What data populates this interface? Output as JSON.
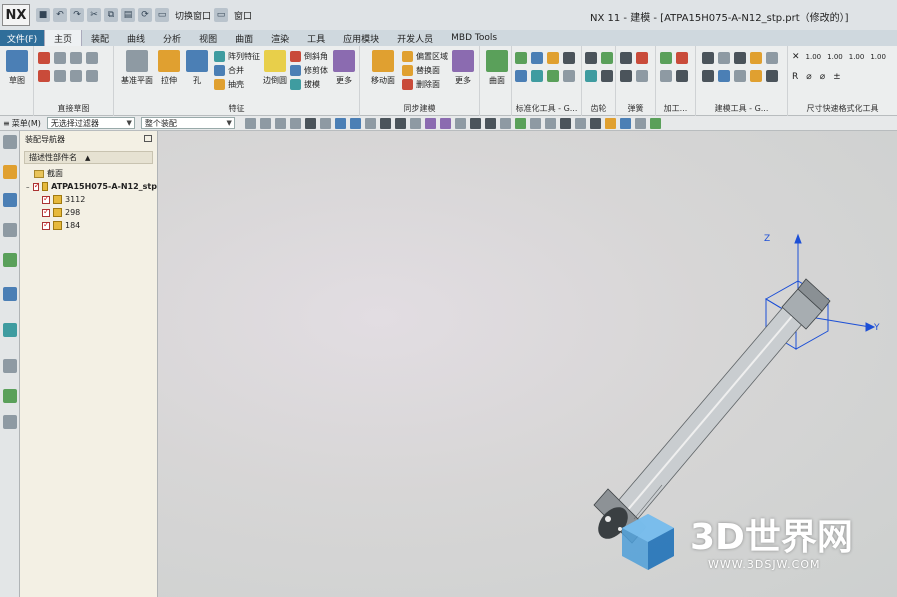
{
  "app": {
    "logo": "NX",
    "window_title": "NX 11 - 建模 - [ATPA15H075-A-N12_stp.prt（修改的）]",
    "quick_access": {
      "switch_window": "切换窗口",
      "window_menu": "窗口"
    }
  },
  "tabs": [
    {
      "label": "文件(F)"
    },
    {
      "label": "主页"
    },
    {
      "label": "装配"
    },
    {
      "label": "曲线"
    },
    {
      "label": "分析"
    },
    {
      "label": "视图"
    },
    {
      "label": "曲面"
    },
    {
      "label": "渲染"
    },
    {
      "label": "工具"
    },
    {
      "label": "应用模块"
    },
    {
      "label": "开发人员"
    },
    {
      "label": "MBD Tools"
    }
  ],
  "ribbon": {
    "sketch": {
      "btn": "草图"
    },
    "direct_sketch": {
      "label": "直接草图"
    },
    "feature": {
      "label": "特征",
      "datum_plane": "基准平面",
      "extrude": "拉伸",
      "hole": "孔",
      "pattern_feature": "阵列特征",
      "unite": "合并",
      "shell": "抽壳",
      "edge_blend": "边倒圆",
      "chamfer": "倒斜角",
      "trim_body": "修剪体",
      "draft": "拔模",
      "more": "更多"
    },
    "sync": {
      "label": "同步建模",
      "move_face": "移动面",
      "offset_region": "偏置区域",
      "replace_face": "替换面",
      "delete_face": "删除面",
      "more": "更多"
    },
    "surface": {
      "btn": "曲面"
    },
    "labels": {
      "standard_tools": "标准化工具 - G...",
      "gear": "齿轮",
      "spring": "弹簧",
      "machining": "加工...",
      "modeling_tools": "建模工具 - G...",
      "dimension_tools": "尺寸快速格式化工具"
    },
    "dim_values": [
      "1.00",
      "1.00",
      "1.00",
      "1.00"
    ]
  },
  "filterbar": {
    "menu": "菜单(M)",
    "filter": "无选择过滤器",
    "scope": "整个装配"
  },
  "navigator": {
    "title": "装配导航器",
    "column": "描述性部件名",
    "rows": [
      {
        "label": "截面",
        "level": 1
      },
      {
        "label": "ATPA15H075-A-N12_stp",
        "level": 0
      },
      {
        "label": "3112",
        "level": 1
      },
      {
        "label": "298",
        "level": 1
      },
      {
        "label": "184",
        "level": 1
      }
    ]
  },
  "csys": {
    "z": "Z",
    "y": "Y"
  },
  "watermark": {
    "brand": "3D世界网",
    "url": "WWW.3DSJW.COM"
  },
  "colors": {
    "file_tab": "#2f6e9a",
    "csys": "#1c4fd6",
    "nav_bg": "#f3f0e4"
  }
}
